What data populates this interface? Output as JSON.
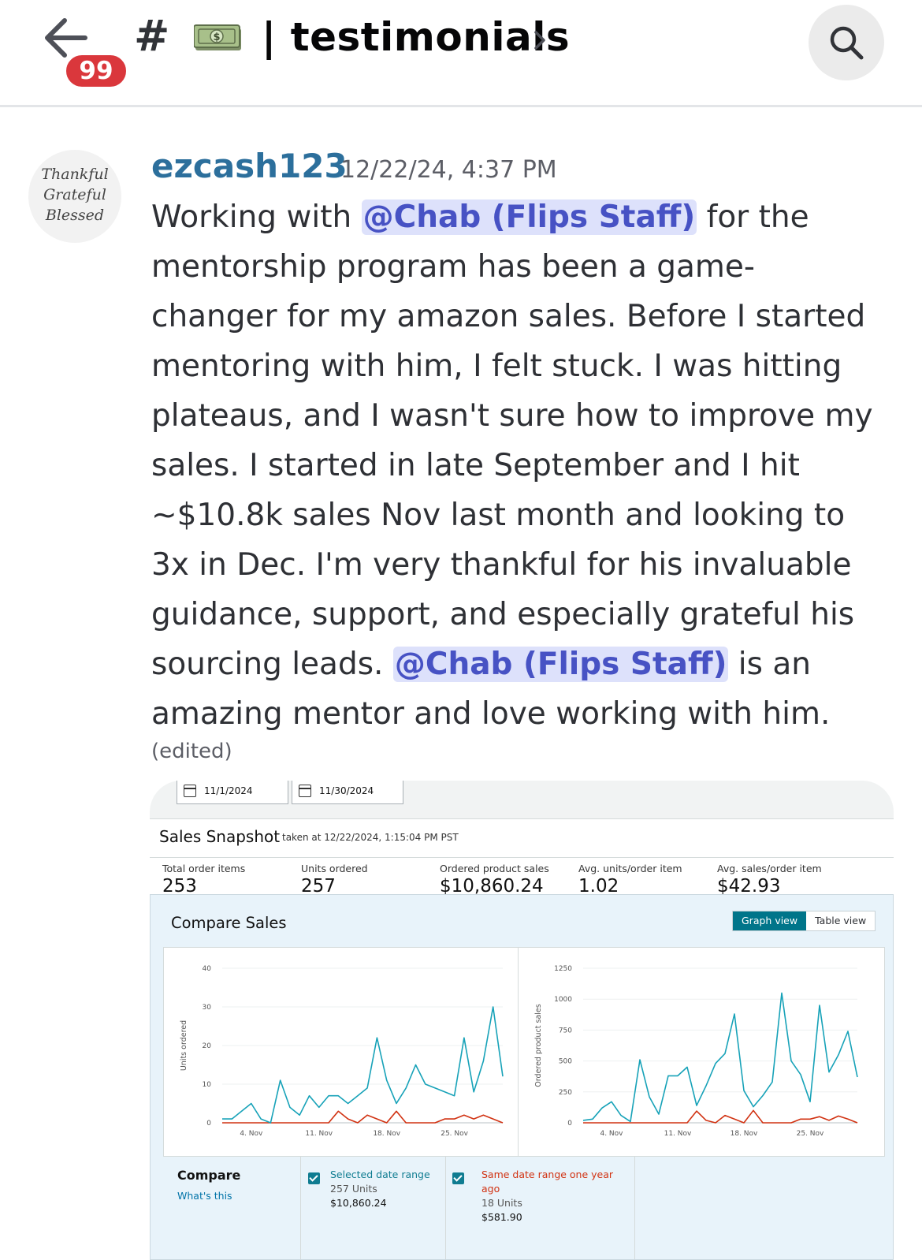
{
  "header": {
    "unread_badge": "99",
    "channel_hash": "#",
    "channel_separator": "|",
    "channel_name": "testimonials"
  },
  "message": {
    "avatar_lines": [
      "Thankful",
      "Grateful",
      "Blessed"
    ],
    "username": "ezcash123",
    "timestamp": "12/22/24, 4:37 PM",
    "lines": [
      [
        "Working with ",
        "@Chab (Flips Staff)",
        " for the"
      ],
      "mentorship program has been a game-",
      "changer for my amazon sales. Before I started",
      "mentoring with him, I felt stuck. I was hitting",
      "plateaus, and I wasn't sure how to improve my",
      "sales.   I started in late September and I hit",
      "~$10.8k sales Nov last month and looking to",
      "3x in Dec.  I'm very thankful for his invaluable",
      "guidance, support, and especially grateful his",
      [
        "sourcing leads.  ",
        "@Chab (Flips Staff)",
        " is an"
      ],
      "amazing mentor and love working with him."
    ],
    "edited_label": "(edited)"
  },
  "attachment": {
    "date_from": "11/1/2024",
    "date_to": "11/30/2024",
    "snapshot_title": "Sales Snapshot",
    "snapshot_taken": "taken at 12/22/2024, 1:15:04 PM PST",
    "metrics": [
      {
        "label": "Total order items",
        "value": "253"
      },
      {
        "label": "Units ordered",
        "value": "257"
      },
      {
        "label": "Ordered product sales",
        "value": "$10,860.24"
      },
      {
        "label": "Avg. units/order item",
        "value": "1.02"
      },
      {
        "label": "Avg. sales/order item",
        "value": "$42.93"
      }
    ],
    "compare_title": "Compare Sales",
    "graph_view_label": "Graph view",
    "table_view_label": "Table view",
    "compare_label": "Compare",
    "whats_this_label": "What's this",
    "legend": [
      {
        "title": "Selected date range",
        "units": "257 Units",
        "amount": "$10,860.24",
        "color": "#0f7c91"
      },
      {
        "title": "Same date range one year ago",
        "title_lines": [
          "Same date range one year",
          "ago"
        ],
        "units": "18 Units",
        "amount": "$581.90",
        "color": "#d13212"
      }
    ]
  },
  "chart_data": [
    {
      "type": "line",
      "ylabel": "Units ordered",
      "ylim": [
        0,
        40
      ],
      "yticks": [
        0,
        10,
        20,
        30,
        40
      ],
      "xtick_labels": [
        "4. Nov",
        "11. Nov",
        "18. Nov",
        "25. Nov"
      ],
      "xtick_days": [
        4,
        11,
        18,
        25
      ],
      "x": [
        1,
        2,
        3,
        4,
        5,
        6,
        7,
        8,
        9,
        10,
        11,
        12,
        13,
        14,
        15,
        16,
        17,
        18,
        19,
        20,
        21,
        22,
        23,
        24,
        25,
        26,
        27,
        28,
        29,
        30
      ],
      "series": [
        {
          "name": "Selected date range",
          "color": "#17a2b8",
          "values": [
            1,
            1,
            3,
            5,
            1,
            0,
            11,
            4,
            2,
            7,
            4,
            7,
            7,
            5,
            7,
            9,
            22,
            11,
            5,
            9,
            15,
            10,
            9,
            8,
            7,
            22,
            8,
            16,
            30,
            12
          ]
        },
        {
          "name": "Same date range one year ago",
          "color": "#d13212",
          "values": [
            0,
            0,
            0,
            0,
            0,
            0,
            0,
            0,
            0,
            0,
            0,
            0,
            3,
            1,
            0,
            2,
            1,
            0,
            3,
            0,
            0,
            0,
            0,
            1,
            1,
            2,
            1,
            2,
            1,
            0
          ]
        }
      ]
    },
    {
      "type": "line",
      "ylabel": "Ordered product sales",
      "ylim": [
        0,
        1250
      ],
      "yticks": [
        0,
        250,
        500,
        750,
        1000,
        1250
      ],
      "xtick_labels": [
        "4. Nov",
        "11. Nov",
        "18. Nov",
        "25. Nov"
      ],
      "xtick_days": [
        4,
        11,
        18,
        25
      ],
      "x": [
        1,
        2,
        3,
        4,
        5,
        6,
        7,
        8,
        9,
        10,
        11,
        12,
        13,
        14,
        15,
        16,
        17,
        18,
        19,
        20,
        21,
        22,
        23,
        24,
        25,
        26,
        27,
        28,
        29,
        30
      ],
      "series": [
        {
          "name": "Selected date range",
          "color": "#17a2b8",
          "values": [
            20,
            30,
            120,
            170,
            60,
            10,
            510,
            210,
            70,
            380,
            380,
            450,
            140,
            300,
            480,
            560,
            880,
            260,
            130,
            220,
            330,
            1050,
            500,
            390,
            170,
            950,
            410,
            550,
            740,
            370
          ]
        },
        {
          "name": "Same date range one year ago",
          "color": "#d13212",
          "values": [
            0,
            0,
            0,
            0,
            0,
            0,
            0,
            0,
            0,
            0,
            0,
            0,
            95,
            20,
            0,
            60,
            30,
            0,
            100,
            0,
            0,
            0,
            0,
            30,
            30,
            50,
            20,
            55,
            30,
            0
          ]
        }
      ]
    }
  ]
}
